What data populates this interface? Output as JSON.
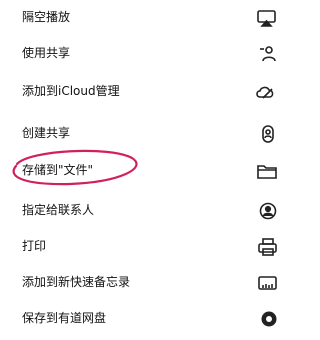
{
  "menu": {
    "items": [
      {
        "label": "隔空播放",
        "icon": "airplay-icon"
      },
      {
        "label": "使用共享",
        "icon": "share-person-icon"
      },
      {
        "label": "添加到iCloud管理",
        "icon": "cloud-pencil-icon"
      },
      {
        "label": "创建共享",
        "icon": "person-badge-icon"
      },
      {
        "label": "存储到\"文件\"",
        "icon": "folder-icon"
      },
      {
        "label": "指定给联系人",
        "icon": "contact-circle-icon"
      },
      {
        "label": "打印",
        "icon": "printer-icon"
      },
      {
        "label": "添加到新快速备忘录",
        "icon": "memo-icon"
      },
      {
        "label": "保存到有道网盘",
        "icon": "youdao-disk-icon"
      }
    ]
  },
  "annotation": {
    "color": "#d1205f",
    "target": "存储到\"文件\""
  }
}
